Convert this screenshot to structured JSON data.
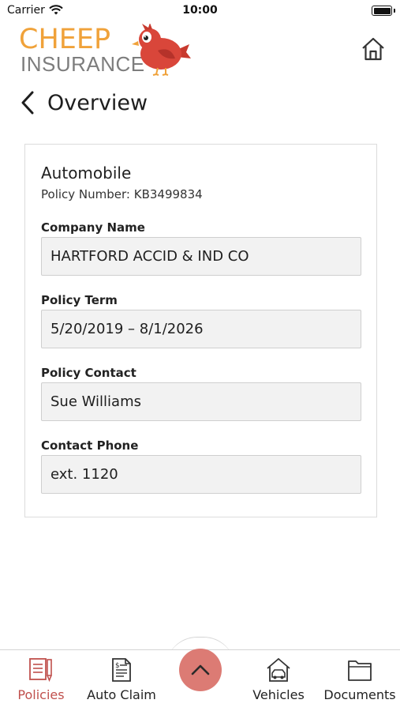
{
  "status_bar": {
    "carrier": "Carrier",
    "time": "10:00"
  },
  "header": {
    "logo_line1": "CHEEP",
    "logo_line2": "INSURANCE",
    "brand_orange": "#f0a23a",
    "brand_red": "#c0504d"
  },
  "nav": {
    "title": "Overview"
  },
  "policy": {
    "type": "Automobile",
    "number_label": "Policy Number: KB3499834",
    "fields": [
      {
        "label": "Company Name",
        "value": "HARTFORD ACCID & IND CO"
      },
      {
        "label": "Policy Term",
        "value": "5/20/2019 – 8/1/2026"
      },
      {
        "label": "Policy Contact",
        "value": "Sue Williams"
      },
      {
        "label": "Contact Phone",
        "value": "ext. 1120"
      }
    ]
  },
  "tabbar": {
    "tabs": [
      {
        "label": "Policies",
        "icon": "policies-icon",
        "active": true
      },
      {
        "label": "Auto Claim",
        "icon": "auto-claim-icon",
        "active": false
      },
      {
        "label": "Vehicles",
        "icon": "vehicles-icon",
        "active": false
      },
      {
        "label": "Documents",
        "icon": "documents-icon",
        "active": false
      }
    ],
    "fab_icon": "chevron-up-icon",
    "fab_color": "#dc7b74"
  }
}
